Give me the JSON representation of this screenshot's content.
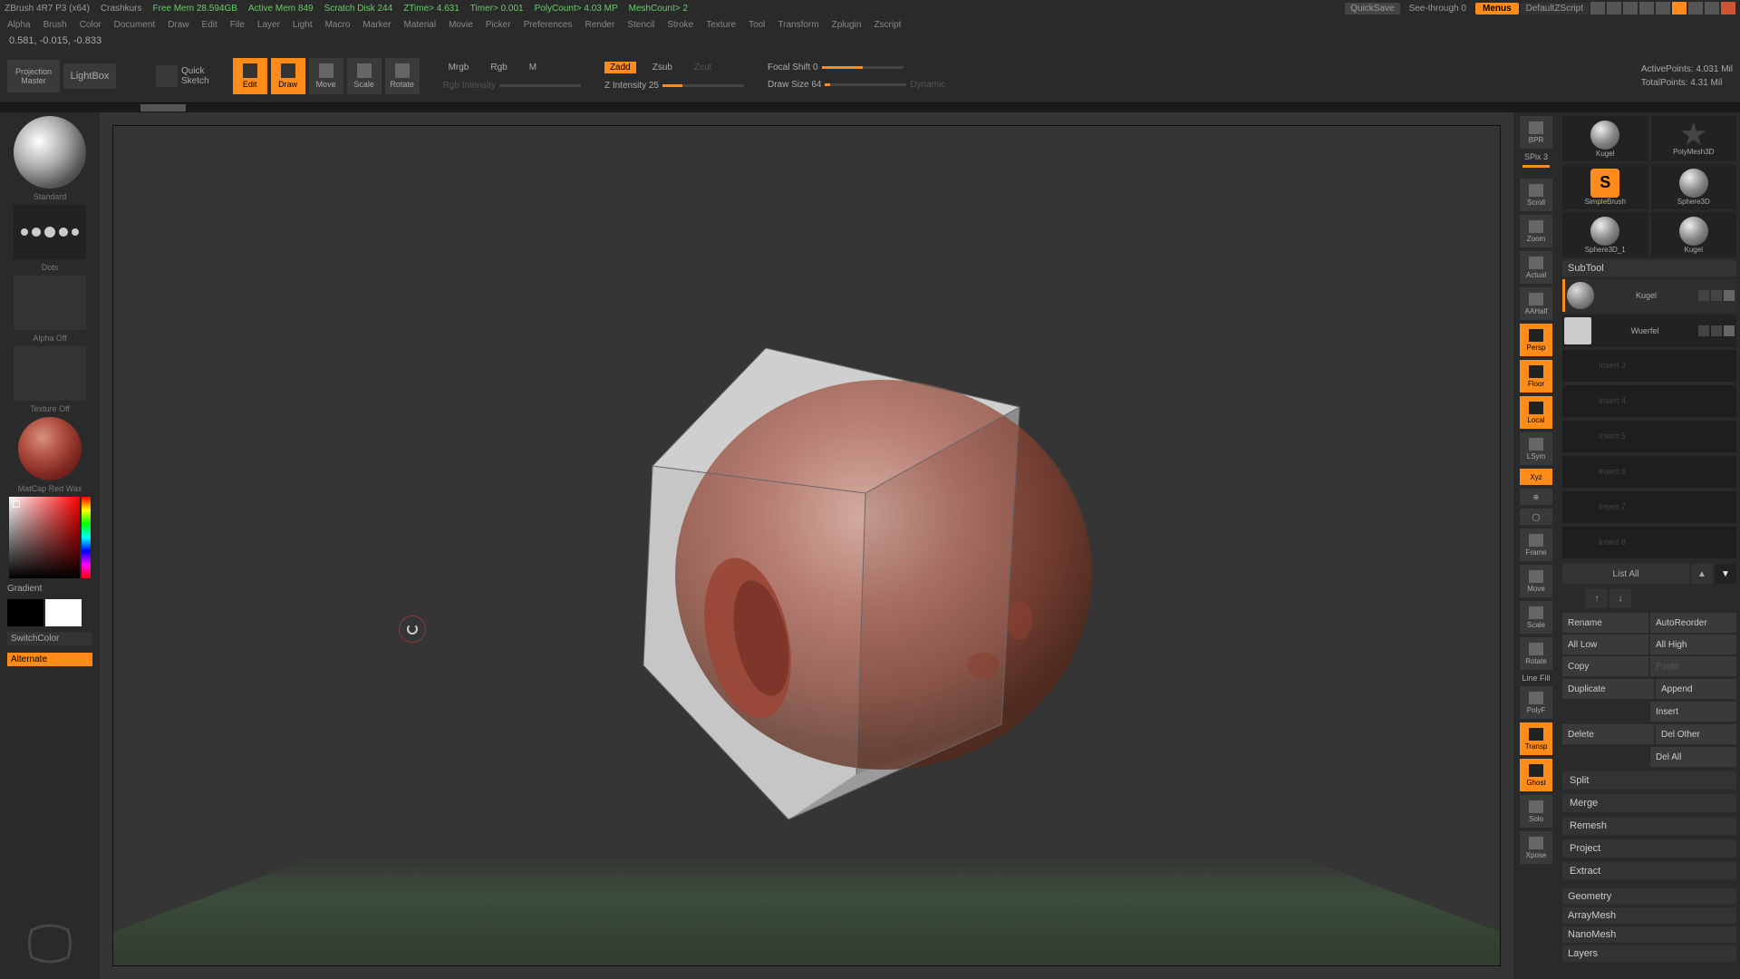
{
  "titlebar": {
    "app": "ZBrush 4R7 P3 (x64)",
    "project": "Crashkurs",
    "freemem": "Free Mem 28.594GB",
    "activemem": "Active Mem 849",
    "scratch": "Scratch Disk 244",
    "ztime": "ZTime> 4.631",
    "timer": "Timer> 0.001",
    "polycount": "PolyCount> 4.03 MP",
    "meshcount": "MeshCount> 2",
    "quicksave": "QuickSave",
    "seethrough": "See-through   0",
    "menus": "Menus",
    "defaultzscript": "DefaultZScript"
  },
  "menubar": [
    "Alpha",
    "Brush",
    "Color",
    "Document",
    "Draw",
    "Edit",
    "File",
    "Layer",
    "Light",
    "Macro",
    "Marker",
    "Material",
    "Movie",
    "Picker",
    "Preferences",
    "Render",
    "Stencil",
    "Stroke",
    "Texture",
    "Tool",
    "Transform",
    "Zplugin",
    "Zscript"
  ],
  "coords": "0.581, -0.015, -0.833",
  "toolbar": {
    "projmaster1": "Projection",
    "projmaster2": "Master",
    "lightbox": "LightBox",
    "quicksketch1": "Quick",
    "quicksketch2": "Sketch",
    "edit": "Edit",
    "draw": "Draw",
    "move": "Move",
    "scale": "Scale",
    "rotate": "Rotate",
    "mrgb": "Mrgb",
    "rgb": "Rgb",
    "m": "M",
    "rgbintensity": "Rgb Intensity",
    "zadd": "Zadd",
    "zsub": "Zsub",
    "zcut": "Zcut",
    "zintensity": "Z Intensity 25",
    "focalshift": "Focal Shift 0",
    "drawsize": "Draw Size 64",
    "dynamic": "Dynamic",
    "activepoints": "ActivePoints: 4.031 Mil",
    "totalpoints": "TotalPoints: 4.31 Mil"
  },
  "left": {
    "brush": "Standard",
    "stroke": "Dots",
    "alpha": "Alpha Off",
    "texture": "Texture Off",
    "material": "MatCap Red Wax",
    "gradient": "Gradient",
    "switchcolor": "SwitchColor",
    "alternate": "Alternate"
  },
  "gutter": {
    "bpr": "BPR",
    "spix": "SPix 3",
    "scroll": "Scroll",
    "zoom": "Zoom",
    "actual": "Actual",
    "aahalf": "AAHalf",
    "persp": "Persp",
    "floor": "Floor",
    "local": "Local",
    "lsym": "LSym",
    "xyz": "Xyz",
    "frame": "Frame",
    "move": "Move",
    "scale": "Scale",
    "rotate": "Rotate",
    "linefill": "Line Fill",
    "polyf": "PolyF",
    "transp": "Transp",
    "ghost": "Ghost",
    "solo": "Solo",
    "xpose": "Xpose"
  },
  "tools": {
    "kugel": "Kugel",
    "polymesh": "PolyMesh3D",
    "simplebrush": "SimpleBrush",
    "sphere3d": "Sphere3D",
    "sphere3d1": "Sphere3D_1",
    "kugel2": "Kugel"
  },
  "subtool": {
    "header": "SubTool",
    "item1": "Kugel",
    "item2": "Wuerfel",
    "slot3": "Insert 3",
    "slot4": "Insert 4",
    "slot5": "Insert 5",
    "slot6": "Insert 6",
    "slot7": "Insert 7",
    "slot8": "Insert 8",
    "listall": "List All",
    "rename": "Rename",
    "autoreorder": "AutoReorder",
    "alllow": "All Low",
    "allhigh": "All High",
    "copy": "Copy",
    "paste": "Paste",
    "duplicate": "Duplicate",
    "append": "Append",
    "insert": "Insert",
    "delete": "Delete",
    "delother": "Del Other",
    "delall": "Del All",
    "split": "Split",
    "merge": "Merge",
    "remesh": "Remesh",
    "project": "Project",
    "extract": "Extract",
    "geometry": "Geometry",
    "arraymesh": "ArrayMesh",
    "nanomesh": "NanoMesh",
    "layers": "Layers"
  }
}
